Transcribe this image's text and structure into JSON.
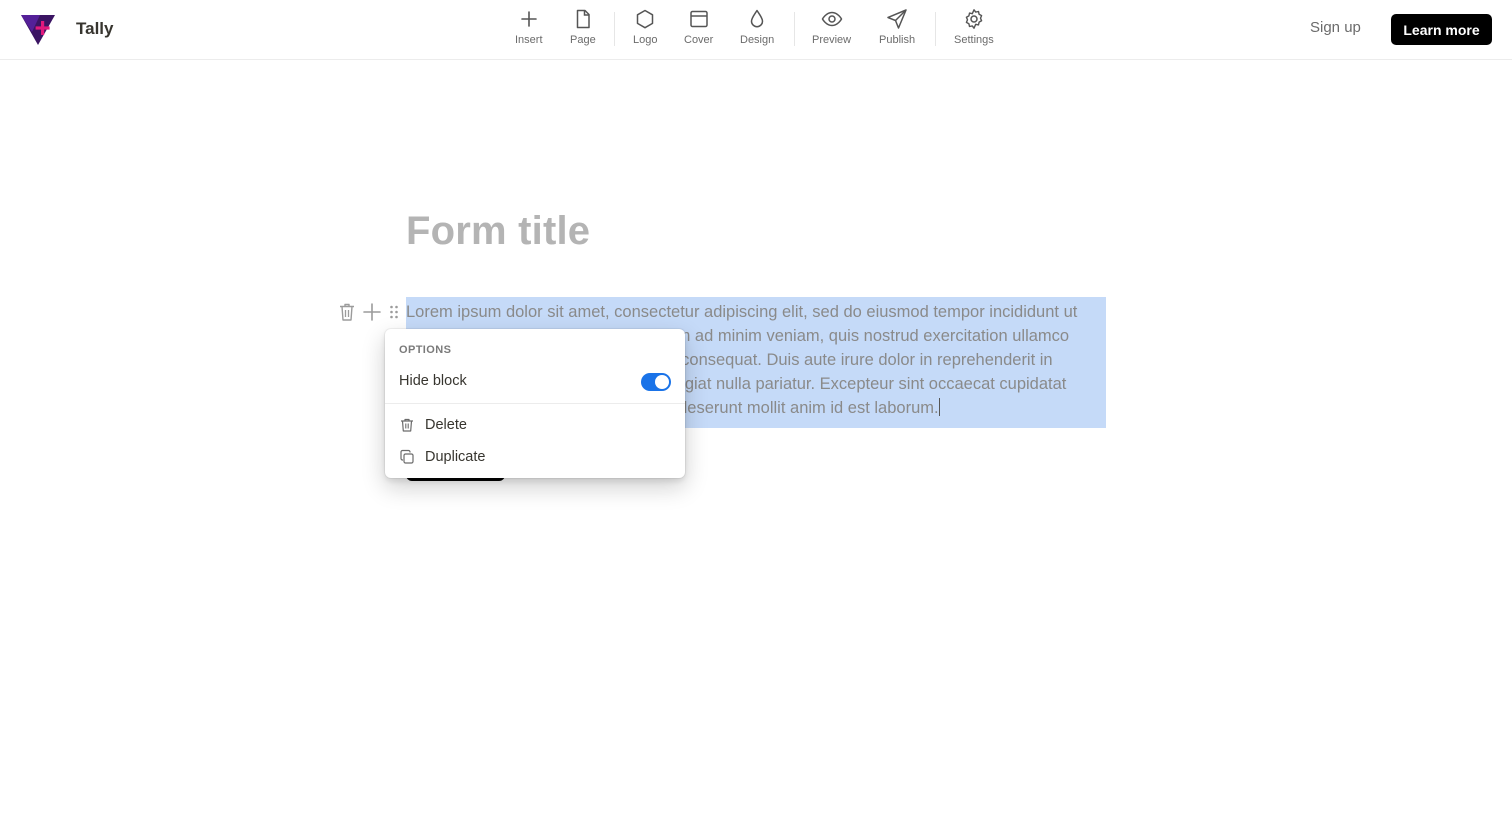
{
  "app": {
    "name": "Tally"
  },
  "toolbar": {
    "items": [
      {
        "label": "Insert",
        "icon": "plus-icon"
      },
      {
        "label": "Page",
        "icon": "page-icon"
      },
      {
        "label": "Logo",
        "icon": "hexagon-icon"
      },
      {
        "label": "Cover",
        "icon": "cover-icon"
      },
      {
        "label": "Design",
        "icon": "droplet-icon"
      },
      {
        "label": "Preview",
        "icon": "eye-icon"
      },
      {
        "label": "Publish",
        "icon": "send-icon"
      },
      {
        "label": "Settings",
        "icon": "gear-icon"
      }
    ]
  },
  "header": {
    "signup_label": "Sign up",
    "learn_more_label": "Learn more"
  },
  "form": {
    "title_placeholder": "Form title",
    "text_block": "Lorem ipsum dolor sit amet, consectetur adipiscing elit, sed do eiusmod tempor incididunt ut labore et dolore magna aliqua. Ut enim ad minim veniam, quis nostrud exercitation ullamco laboris nisi ut aliquip ex ea commodo consequat. Duis aute irure dolor in reprehenderit in voluptate velit esse cillum dolore eu fugiat nulla pariatur. Excepteur sint occaecat cupidatat non proident, sunt in culpa qui officia deserunt mollit anim id est laborum."
  },
  "options_menu": {
    "heading": "OPTIONS",
    "hide_block_label": "Hide block",
    "hide_block_enabled": true,
    "delete_label": "Delete",
    "duplicate_label": "Duplicate"
  },
  "colors": {
    "accent": "#1a73e8",
    "selection": "#c5daf8",
    "logo_purple": "#3b1463",
    "logo_pink": "#e0197d"
  }
}
